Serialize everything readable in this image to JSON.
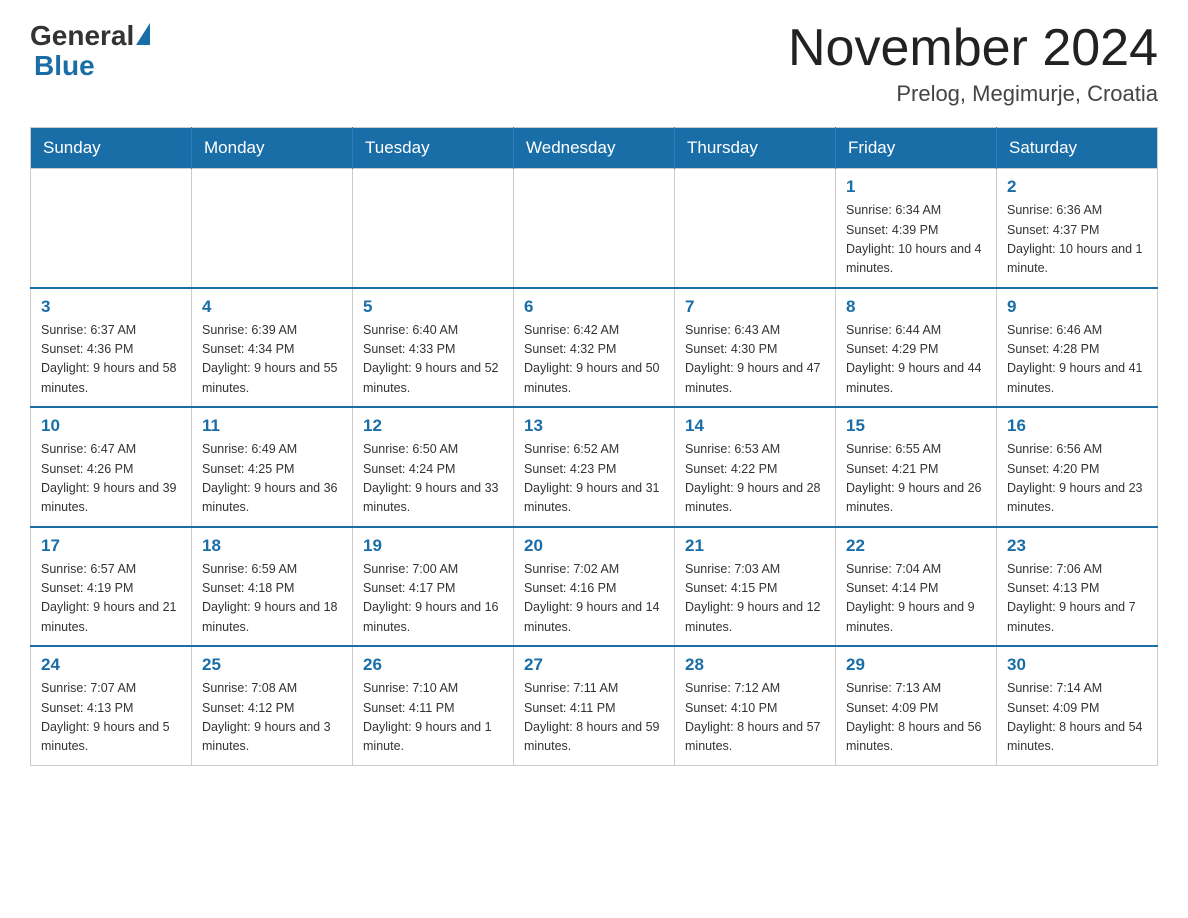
{
  "header": {
    "logo_general": "General",
    "logo_blue": "Blue",
    "month_title": "November 2024",
    "location": "Prelog, Megimurje, Croatia"
  },
  "days_of_week": [
    "Sunday",
    "Monday",
    "Tuesday",
    "Wednesday",
    "Thursday",
    "Friday",
    "Saturday"
  ],
  "weeks": [
    [
      {
        "day": "",
        "info": ""
      },
      {
        "day": "",
        "info": ""
      },
      {
        "day": "",
        "info": ""
      },
      {
        "day": "",
        "info": ""
      },
      {
        "day": "",
        "info": ""
      },
      {
        "day": "1",
        "info": "Sunrise: 6:34 AM\nSunset: 4:39 PM\nDaylight: 10 hours\nand 4 minutes."
      },
      {
        "day": "2",
        "info": "Sunrise: 6:36 AM\nSunset: 4:37 PM\nDaylight: 10 hours\nand 1 minute."
      }
    ],
    [
      {
        "day": "3",
        "info": "Sunrise: 6:37 AM\nSunset: 4:36 PM\nDaylight: 9 hours\nand 58 minutes."
      },
      {
        "day": "4",
        "info": "Sunrise: 6:39 AM\nSunset: 4:34 PM\nDaylight: 9 hours\nand 55 minutes."
      },
      {
        "day": "5",
        "info": "Sunrise: 6:40 AM\nSunset: 4:33 PM\nDaylight: 9 hours\nand 52 minutes."
      },
      {
        "day": "6",
        "info": "Sunrise: 6:42 AM\nSunset: 4:32 PM\nDaylight: 9 hours\nand 50 minutes."
      },
      {
        "day": "7",
        "info": "Sunrise: 6:43 AM\nSunset: 4:30 PM\nDaylight: 9 hours\nand 47 minutes."
      },
      {
        "day": "8",
        "info": "Sunrise: 6:44 AM\nSunset: 4:29 PM\nDaylight: 9 hours\nand 44 minutes."
      },
      {
        "day": "9",
        "info": "Sunrise: 6:46 AM\nSunset: 4:28 PM\nDaylight: 9 hours\nand 41 minutes."
      }
    ],
    [
      {
        "day": "10",
        "info": "Sunrise: 6:47 AM\nSunset: 4:26 PM\nDaylight: 9 hours\nand 39 minutes."
      },
      {
        "day": "11",
        "info": "Sunrise: 6:49 AM\nSunset: 4:25 PM\nDaylight: 9 hours\nand 36 minutes."
      },
      {
        "day": "12",
        "info": "Sunrise: 6:50 AM\nSunset: 4:24 PM\nDaylight: 9 hours\nand 33 minutes."
      },
      {
        "day": "13",
        "info": "Sunrise: 6:52 AM\nSunset: 4:23 PM\nDaylight: 9 hours\nand 31 minutes."
      },
      {
        "day": "14",
        "info": "Sunrise: 6:53 AM\nSunset: 4:22 PM\nDaylight: 9 hours\nand 28 minutes."
      },
      {
        "day": "15",
        "info": "Sunrise: 6:55 AM\nSunset: 4:21 PM\nDaylight: 9 hours\nand 26 minutes."
      },
      {
        "day": "16",
        "info": "Sunrise: 6:56 AM\nSunset: 4:20 PM\nDaylight: 9 hours\nand 23 minutes."
      }
    ],
    [
      {
        "day": "17",
        "info": "Sunrise: 6:57 AM\nSunset: 4:19 PM\nDaylight: 9 hours\nand 21 minutes."
      },
      {
        "day": "18",
        "info": "Sunrise: 6:59 AM\nSunset: 4:18 PM\nDaylight: 9 hours\nand 18 minutes."
      },
      {
        "day": "19",
        "info": "Sunrise: 7:00 AM\nSunset: 4:17 PM\nDaylight: 9 hours\nand 16 minutes."
      },
      {
        "day": "20",
        "info": "Sunrise: 7:02 AM\nSunset: 4:16 PM\nDaylight: 9 hours\nand 14 minutes."
      },
      {
        "day": "21",
        "info": "Sunrise: 7:03 AM\nSunset: 4:15 PM\nDaylight: 9 hours\nand 12 minutes."
      },
      {
        "day": "22",
        "info": "Sunrise: 7:04 AM\nSunset: 4:14 PM\nDaylight: 9 hours\nand 9 minutes."
      },
      {
        "day": "23",
        "info": "Sunrise: 7:06 AM\nSunset: 4:13 PM\nDaylight: 9 hours\nand 7 minutes."
      }
    ],
    [
      {
        "day": "24",
        "info": "Sunrise: 7:07 AM\nSunset: 4:13 PM\nDaylight: 9 hours\nand 5 minutes."
      },
      {
        "day": "25",
        "info": "Sunrise: 7:08 AM\nSunset: 4:12 PM\nDaylight: 9 hours\nand 3 minutes."
      },
      {
        "day": "26",
        "info": "Sunrise: 7:10 AM\nSunset: 4:11 PM\nDaylight: 9 hours\nand 1 minute."
      },
      {
        "day": "27",
        "info": "Sunrise: 7:11 AM\nSunset: 4:11 PM\nDaylight: 8 hours\nand 59 minutes."
      },
      {
        "day": "28",
        "info": "Sunrise: 7:12 AM\nSunset: 4:10 PM\nDaylight: 8 hours\nand 57 minutes."
      },
      {
        "day": "29",
        "info": "Sunrise: 7:13 AM\nSunset: 4:09 PM\nDaylight: 8 hours\nand 56 minutes."
      },
      {
        "day": "30",
        "info": "Sunrise: 7:14 AM\nSunset: 4:09 PM\nDaylight: 8 hours\nand 54 minutes."
      }
    ]
  ]
}
